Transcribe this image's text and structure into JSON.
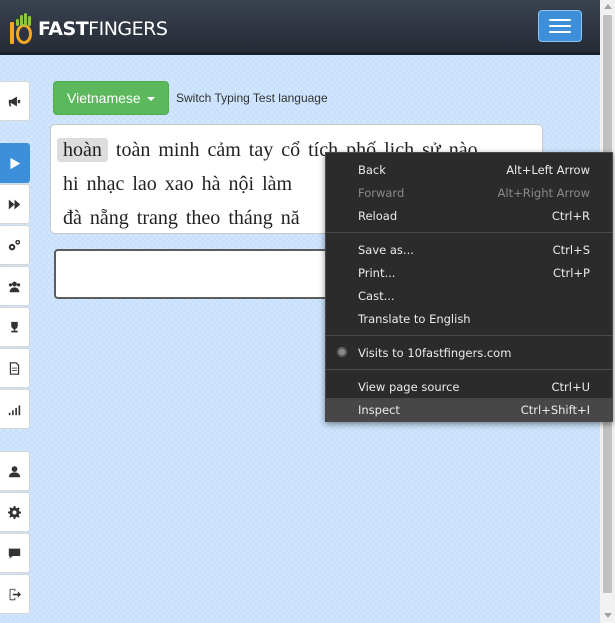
{
  "logo": {
    "brand_bold": "FAST",
    "brand_light": "FINGERS",
    "icon": "10fastfingers-logo-icon"
  },
  "nav": {
    "menu_icon": "hamburger-menu-icon"
  },
  "sidebar": {
    "items": [
      {
        "icon": "megaphone-icon",
        "active": false
      },
      {
        "icon": "play-icon",
        "active": true
      },
      {
        "icon": "fast-forward-icon",
        "active": false
      },
      {
        "icon": "cogs-icon",
        "active": false
      },
      {
        "icon": "users-icon",
        "active": false
      },
      {
        "icon": "trophy-icon",
        "active": false
      },
      {
        "icon": "document-icon",
        "active": false
      },
      {
        "icon": "signal-bars-icon",
        "active": false
      },
      {
        "icon": "user-icon",
        "active": false
      },
      {
        "icon": "gear-icon",
        "active": false
      },
      {
        "icon": "chat-bubble-icon",
        "active": false
      },
      {
        "icon": "logout-icon",
        "active": false
      }
    ]
  },
  "language": {
    "selected": "Vietnamese",
    "switch_label": "Switch Typing Test language"
  },
  "words": {
    "lines": [
      [
        "hoàn",
        "toàn",
        "minh",
        "cảm",
        "tay",
        "cổ",
        "tích",
        "phố",
        "lịch",
        "sử",
        "nào"
      ],
      [
        "hi",
        "nhạc",
        "lao",
        "xao",
        "hà",
        "nội",
        "làm"
      ],
      [
        "đà",
        "nẵng",
        "trang",
        "theo",
        "tháng",
        "nă"
      ]
    ],
    "current_index": 0
  },
  "typing_input": {
    "value": ""
  },
  "context_menu": {
    "groups": [
      [
        {
          "label": "Back",
          "shortcut": "Alt+Left Arrow",
          "disabled": false
        },
        {
          "label": "Forward",
          "shortcut": "Alt+Right Arrow",
          "disabled": true
        },
        {
          "label": "Reload",
          "shortcut": "Ctrl+R",
          "disabled": false
        }
      ],
      [
        {
          "label": "Save as...",
          "shortcut": "Ctrl+S",
          "disabled": false
        },
        {
          "label": "Print...",
          "shortcut": "Ctrl+P",
          "disabled": false
        },
        {
          "label": "Cast...",
          "shortcut": "",
          "disabled": false
        },
        {
          "label": "Translate to English",
          "shortcut": "",
          "disabled": false
        }
      ],
      [
        {
          "label": "Visits to 10fastfingers.com",
          "shortcut": "",
          "disabled": false,
          "icon": "extension-icon"
        }
      ],
      [
        {
          "label": "View page source",
          "shortcut": "Ctrl+U",
          "disabled": false
        },
        {
          "label": "Inspect",
          "shortcut": "Ctrl+Shift+I",
          "disabled": false,
          "hover": true
        }
      ]
    ]
  },
  "colors": {
    "navbar": "#2f3540",
    "accent_blue": "#3e8fd9",
    "language_button": "#5cb85c",
    "page_background": "#c7e0fb",
    "menu_background": "#2b2b2b"
  }
}
